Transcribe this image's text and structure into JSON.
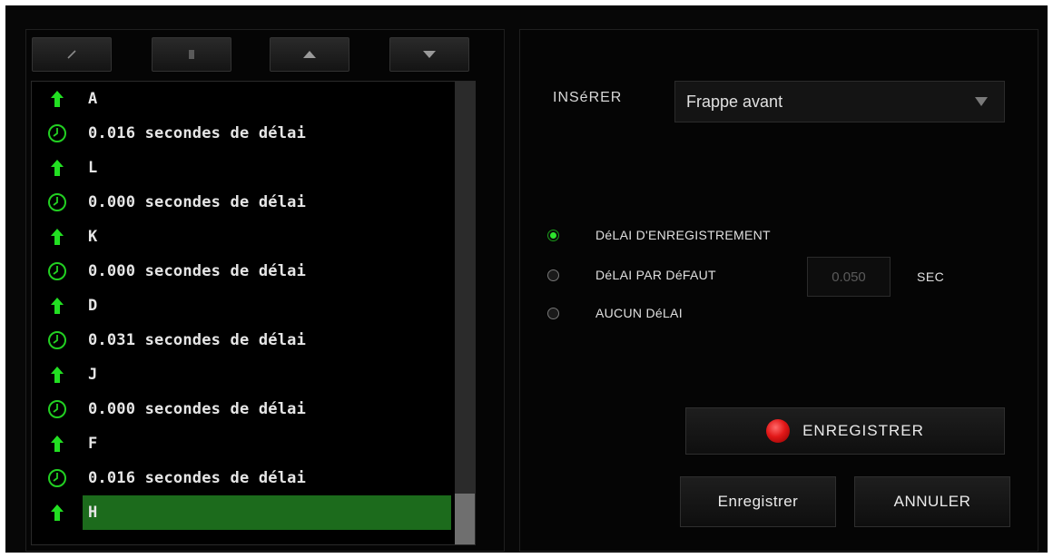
{
  "toolbar": {
    "buttons": [
      {
        "name": "edit-button",
        "icon": "pencil-icon"
      },
      {
        "name": "delete-button",
        "icon": "trash-icon"
      },
      {
        "name": "move-up-button",
        "icon": "arrow-up-icon"
      },
      {
        "name": "move-down-button",
        "icon": "arrow-down-icon"
      }
    ]
  },
  "macro_list": [
    {
      "type": "key",
      "icon": "key-up-arrow-icon",
      "text": "A"
    },
    {
      "type": "delay",
      "icon": "clock-icon",
      "text": "0.016 secondes de délai"
    },
    {
      "type": "key",
      "icon": "key-up-arrow-icon",
      "text": "L"
    },
    {
      "type": "delay",
      "icon": "clock-icon",
      "text": "0.000 secondes de délai"
    },
    {
      "type": "key",
      "icon": "key-up-arrow-icon",
      "text": "K"
    },
    {
      "type": "delay",
      "icon": "clock-icon",
      "text": "0.000 secondes de délai"
    },
    {
      "type": "key",
      "icon": "key-up-arrow-icon",
      "text": "D"
    },
    {
      "type": "delay",
      "icon": "clock-icon",
      "text": "0.031 secondes de délai"
    },
    {
      "type": "key",
      "icon": "key-up-arrow-icon",
      "text": "J"
    },
    {
      "type": "delay",
      "icon": "clock-icon",
      "text": "0.000 secondes de délai"
    },
    {
      "type": "key",
      "icon": "key-up-arrow-icon",
      "text": "F"
    },
    {
      "type": "delay",
      "icon": "clock-icon",
      "text": "0.016 secondes de délai"
    },
    {
      "type": "key",
      "icon": "key-up-arrow-icon",
      "text": "H",
      "selected": true
    }
  ],
  "insert": {
    "label": "INSéRER",
    "selected": "Frappe avant"
  },
  "delay_options": {
    "options": [
      {
        "label": "DéLAI D'ENREGISTREMENT",
        "checked": true
      },
      {
        "label": "DéLAI PAR DéFAUT",
        "checked": false
      },
      {
        "label": "AUCUN DéLAI",
        "checked": false
      }
    ],
    "default_delay_value": "0.050",
    "unit": "SEC"
  },
  "actions": {
    "record_label": "ENREGISTRER",
    "save_label": "Enregistrer",
    "cancel_label": "ANNULER"
  },
  "colors": {
    "accent_green": "#2ee62e",
    "selection_green": "#1c6b1c",
    "record_red": "#e21818",
    "background": "#050505"
  }
}
